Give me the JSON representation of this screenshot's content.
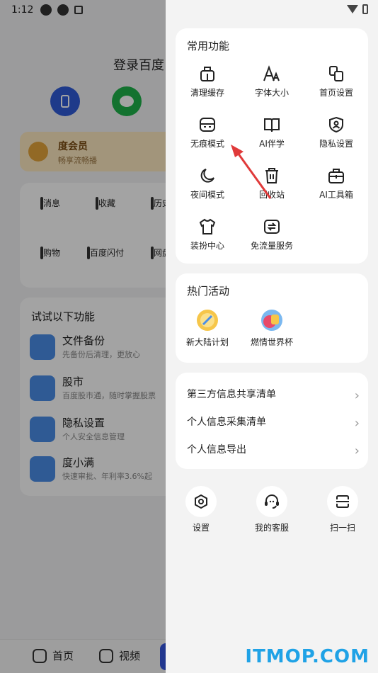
{
  "status": {
    "time": "1:12"
  },
  "background": {
    "login_title": "登录百度",
    "vip": {
      "title": "度会员",
      "subtitle": "畅享流畅播"
    },
    "grid": [
      {
        "label": "消息",
        "icon": "message-icon"
      },
      {
        "label": "收藏",
        "icon": "star-icon"
      },
      {
        "label": "历史",
        "icon": "clock-icon"
      },
      {
        "label": "购物",
        "icon": "cart-icon"
      },
      {
        "label": "百度闪付",
        "icon": "scan-pay-icon"
      },
      {
        "label": "网盘",
        "icon": "cloud-drive-icon"
      }
    ],
    "try_title": "试试以下功能",
    "try_items": [
      {
        "title": "文件备份",
        "subtitle": "先备份后清理，更放心"
      },
      {
        "title": "股市",
        "subtitle": "百度股市通，随时掌握股票"
      },
      {
        "title": "隐私设置",
        "subtitle": "个人安全信息管理"
      },
      {
        "title": "度小满",
        "subtitle": "快速审批、年利率3.6%起"
      }
    ],
    "bottom_nav": [
      {
        "label": "首页",
        "icon": "home-icon"
      },
      {
        "label": "视频",
        "icon": "video-icon"
      }
    ]
  },
  "drawer": {
    "common_title": "常用功能",
    "functions": [
      {
        "label": "清理缓存",
        "icon": "clean-cache-icon"
      },
      {
        "label": "字体大小",
        "icon": "font-size-icon"
      },
      {
        "label": "首页设置",
        "icon": "home-settings-icon"
      },
      {
        "label": "无痕模式",
        "icon": "incognito-icon"
      },
      {
        "label": "AI伴学",
        "icon": "book-icon"
      },
      {
        "label": "隐私设置",
        "icon": "privacy-shield-icon"
      },
      {
        "label": "夜间模式",
        "icon": "moon-icon"
      },
      {
        "label": "回收站",
        "icon": "trash-icon"
      },
      {
        "label": "AI工具箱",
        "icon": "toolbox-icon"
      },
      {
        "label": "装扮中心",
        "icon": "tshirt-icon"
      },
      {
        "label": "免流量服务",
        "icon": "data-free-icon"
      }
    ],
    "hot_title": "热门活动",
    "activities": [
      {
        "label": "新大陆计划",
        "icon": "new-continent-icon"
      },
      {
        "label": "燃情世界杯",
        "icon": "world-cup-icon"
      }
    ],
    "rows": [
      {
        "label": "第三方信息共享清单"
      },
      {
        "label": "个人信息采集清单"
      },
      {
        "label": "个人信息导出"
      }
    ],
    "bottom": [
      {
        "label": "设置",
        "icon": "settings-icon"
      },
      {
        "label": "我的客服",
        "icon": "headset-icon"
      },
      {
        "label": "扫一扫",
        "icon": "scan-icon"
      }
    ],
    "chevron": "›"
  },
  "watermark": "ITMOP.COM",
  "colors": {
    "annotation_arrow": "#e03a3a",
    "watermark": "#1fa2e6"
  }
}
